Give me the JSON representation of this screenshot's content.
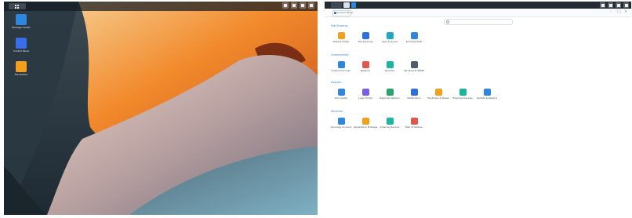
{
  "desktop": {
    "menu_icon": "grid-menu-icon",
    "topbar_icons": [
      "search-icon",
      "user-icon",
      "widgets-icon",
      "options-icon"
    ],
    "icons": [
      {
        "name": "package-center",
        "label": "Package Center",
        "color": "#2e86de"
      },
      {
        "name": "control-panel",
        "label": "Control Panel",
        "color": "#3a6ee8"
      },
      {
        "name": "file-station",
        "label": "File Station",
        "color": "#f0a01c"
      }
    ]
  },
  "window": {
    "tab_label": "Control Panel",
    "controls": [
      "minimize-icon",
      "maximize-icon",
      "close-icon"
    ],
    "sections": [
      {
        "title": "File Sharing",
        "items": [
          {
            "label": "Shared Folder",
            "icon": "shared-folder-icon",
            "color": "#f0a01c"
          },
          {
            "label": "File Services",
            "icon": "file-services-icon",
            "color": "#2e6fe0"
          },
          {
            "label": "User & Group",
            "icon": "user-group-icon",
            "color": "#23a7c8"
          },
          {
            "label": "Domain/LDAP",
            "icon": "domain-ldap-icon",
            "color": "#2e86de"
          }
        ]
      },
      {
        "title": "Connectivity",
        "items": [
          {
            "label": "External Access",
            "icon": "external-access-icon",
            "color": "#2e86de"
          },
          {
            "label": "Network",
            "icon": "network-icon",
            "color": "#e0574d"
          },
          {
            "label": "Security",
            "icon": "security-icon",
            "color": "#1bb5a0"
          },
          {
            "label": "Terminal & SNMP",
            "icon": "terminal-icon",
            "color": "#4d5d6e"
          }
        ]
      },
      {
        "title": "System",
        "items": [
          {
            "label": "Info Center",
            "icon": "info-center-icon",
            "color": "#2e86de"
          },
          {
            "label": "Login Portal",
            "icon": "login-portal-icon",
            "color": "#7a5fe0"
          },
          {
            "label": "Regional Options",
            "icon": "regional-options-icon",
            "color": "#2ba36b"
          },
          {
            "label": "Notification",
            "icon": "notification-icon",
            "color": "#2e6fe0"
          },
          {
            "label": "Hardware & Power",
            "icon": "hardware-power-icon",
            "color": "#f0a01c"
          },
          {
            "label": "External Devices",
            "icon": "external-devices-icon",
            "color": "#1bb5a0"
          },
          {
            "label": "Update & Restore",
            "icon": "update-restore-icon",
            "color": "#2e86de"
          }
        ]
      },
      {
        "title": "Services",
        "items": [
          {
            "label": "Synology Account",
            "icon": "synology-account-icon",
            "color": "#2e86de"
          },
          {
            "label": "Application Privileges",
            "icon": "app-privileges-icon",
            "color": "#f0a01c"
          },
          {
            "label": "Indexing Service",
            "icon": "indexing-service-icon",
            "color": "#1bb5a0"
          },
          {
            "label": "Task Scheduler",
            "icon": "task-scheduler-icon",
            "color": "#e0574d"
          }
        ]
      }
    ]
  }
}
